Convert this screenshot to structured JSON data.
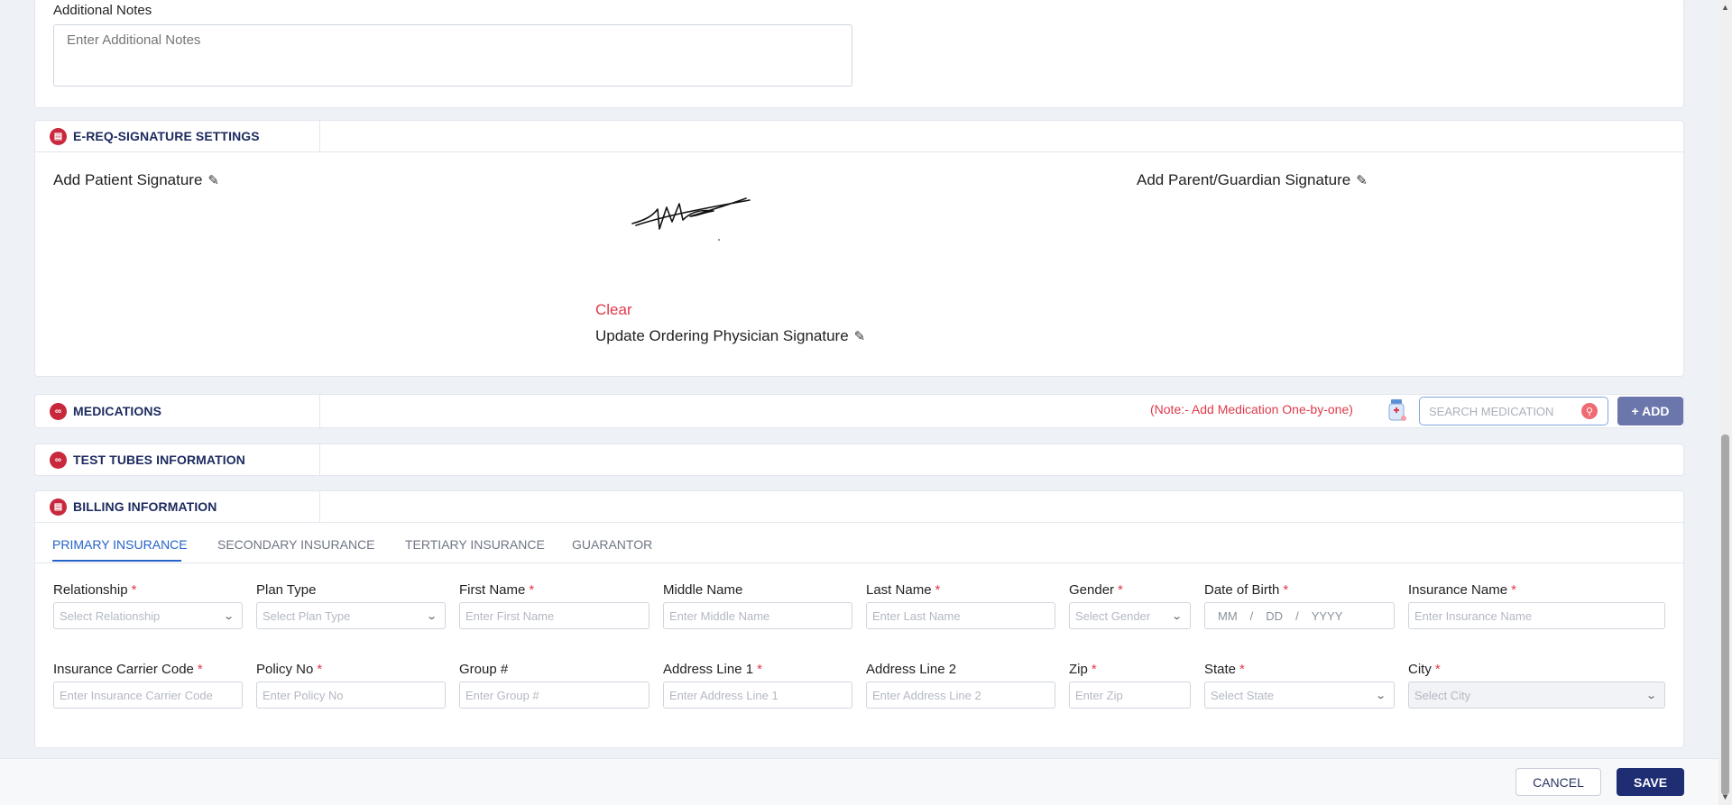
{
  "notes": {
    "label": "Additional Notes",
    "placeholder": "Enter Additional Notes"
  },
  "signature": {
    "section_title": "E-REQ-SIGNATURE SETTINGS",
    "patient_label": "Add Patient Signature",
    "guardian_label": "Add Parent/Guardian Signature",
    "clear_label": "Clear",
    "physician_label": "Update Ordering Physician Signature"
  },
  "medications": {
    "section_title": "MEDICATIONS",
    "note": "(Note:- Add Medication One-by-one)",
    "search_placeholder": "SEARCH MEDICATION",
    "add_label": "+ ADD"
  },
  "test_tubes": {
    "section_title": "TEST TUBES INFORMATION"
  },
  "billing": {
    "section_title": "BILLING INFORMATION",
    "tabs": [
      {
        "label": "PRIMARY INSURANCE",
        "active": true
      },
      {
        "label": "SECONDARY INSURANCE",
        "active": false
      },
      {
        "label": "TERTIARY INSURANCE",
        "active": false
      },
      {
        "label": "GUARANTOR",
        "active": false
      }
    ],
    "fields": {
      "relationship": {
        "label": "Relationship",
        "placeholder": "Select Relationship",
        "required": true
      },
      "plan_type": {
        "label": "Plan Type",
        "placeholder": "Select Plan Type",
        "required": false
      },
      "first_name": {
        "label": "First Name",
        "placeholder": "Enter First Name",
        "required": true
      },
      "middle_name": {
        "label": "Middle Name",
        "placeholder": "Enter Middle Name",
        "required": false
      },
      "last_name": {
        "label": "Last Name",
        "placeholder": "Enter Last Name",
        "required": true
      },
      "gender": {
        "label": "Gender",
        "placeholder": "Select Gender",
        "required": true
      },
      "dob": {
        "label": "Date of Birth",
        "mm": "MM",
        "dd": "DD",
        "yyyy": "YYYY",
        "sep": "/",
        "required": true
      },
      "insurance_name": {
        "label": "Insurance Name",
        "placeholder": "Enter Insurance Name",
        "required": true
      },
      "carrier_code": {
        "label": "Insurance Carrier Code",
        "placeholder": "Enter Insurance Carrier Code",
        "required": true
      },
      "policy_no": {
        "label": "Policy No",
        "placeholder": "Enter Policy No",
        "required": true
      },
      "group": {
        "label": "Group #",
        "placeholder": "Enter Group #",
        "required": false
      },
      "address1": {
        "label": "Address Line 1",
        "placeholder": "Enter Address Line 1",
        "required": true
      },
      "address2": {
        "label": "Address Line 2",
        "placeholder": "Enter Address Line 2",
        "required": false
      },
      "zip": {
        "label": "Zip",
        "placeholder": "Enter Zip",
        "required": true
      },
      "state": {
        "label": "State",
        "placeholder": "Select State",
        "required": true
      },
      "city": {
        "label": "City",
        "placeholder": "Select City",
        "required": true
      }
    },
    "required_mark": "*"
  },
  "footer": {
    "cancel_label": "CANCEL",
    "save_label": "SAVE"
  },
  "colors": {
    "accent": "#2563c9",
    "brand_navy": "#1f2d73",
    "required_red": "#e0394a",
    "section_icon_red": "#c8283c"
  }
}
